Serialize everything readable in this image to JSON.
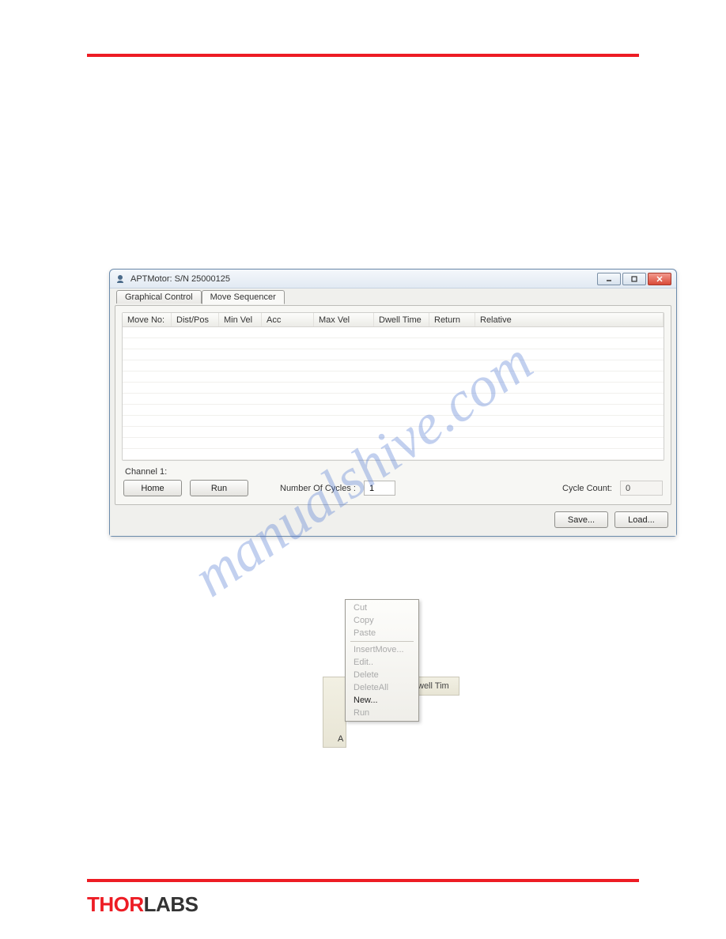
{
  "window": {
    "title": "APTMotor: S/N 25000125",
    "tabs": {
      "graphical": "Graphical Control",
      "sequencer": "Move Sequencer"
    },
    "columns": {
      "moveno": "Move No:",
      "distpos": "Dist/Pos",
      "minvel": "Min Vel",
      "acc": "Acc",
      "maxvel": "Max Vel",
      "dwell": "Dwell Time",
      "return": "Return",
      "relative": "Relative"
    },
    "channel_label": "Channel 1:",
    "home_btn": "Home",
    "run_btn": "Run",
    "numcycles_label": "Number Of Cycles :",
    "numcycles_value": "1",
    "cyclecount_label": "Cycle Count:",
    "cyclecount_value": "0",
    "save_btn": "Save...",
    "load_btn": "Load..."
  },
  "context_menu": {
    "cut": "Cut",
    "copy": "Copy",
    "paste": "Paste",
    "insertmove": "InsertMove...",
    "edit": "Edit..",
    "delete": "Delete",
    "deleteall": "DeleteAll",
    "new": "New...",
    "run": "Run",
    "bg_label": "A",
    "bg_label2": "well Tim"
  },
  "watermark": "manualshive.com",
  "logo": {
    "thor": "THOR",
    "labs": "LABS"
  }
}
